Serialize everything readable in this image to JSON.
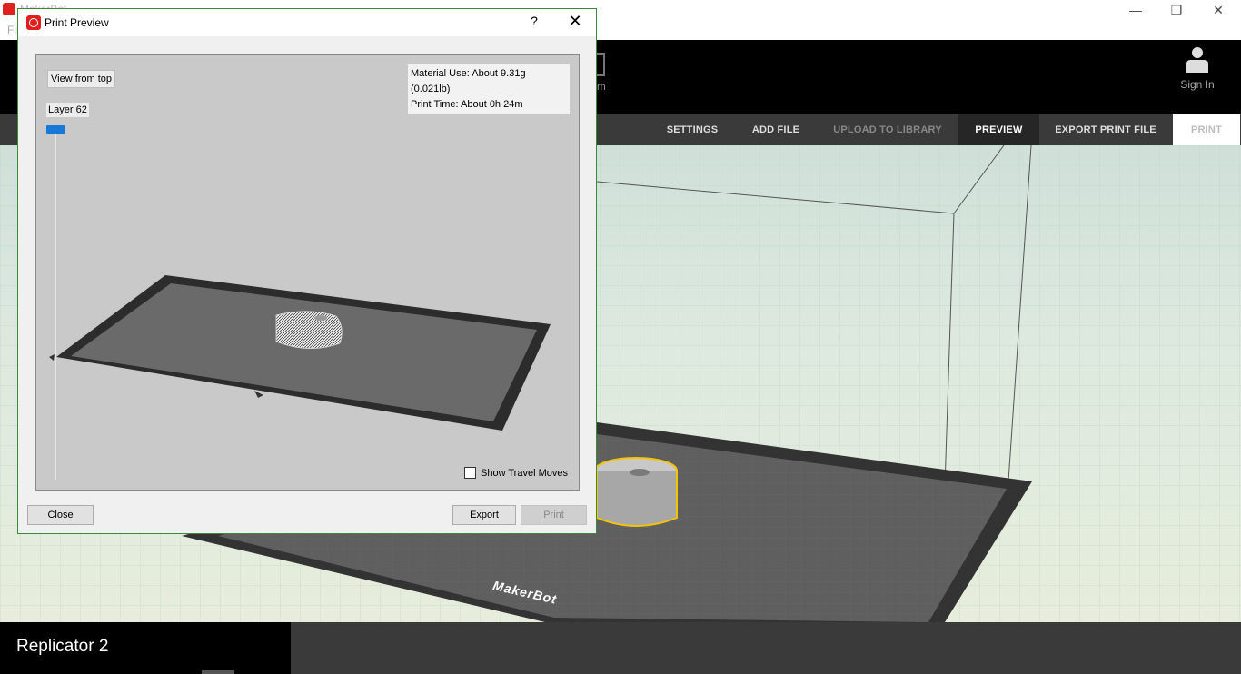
{
  "window": {
    "app_title": "MakerBot",
    "menu_file": "Fil",
    "minimize": "—",
    "restore": "❐",
    "close": "✕"
  },
  "topbar": {
    "learn_label": "rn",
    "signin_label": "Sign In"
  },
  "nav": {
    "settings": "SETTINGS",
    "add_file": "ADD FILE",
    "upload": "UPLOAD TO LIBRARY",
    "preview": "PREVIEW",
    "export": "EXPORT PRINT FILE",
    "print": "PRINT"
  },
  "scene": {
    "bed_logo": "MakerBot"
  },
  "bottombar": {
    "printer_name": "Replicator 2"
  },
  "dialog": {
    "title": "Print Preview",
    "help": "?",
    "close_glyph": "✕",
    "view_from_top": "View from top",
    "material_use": "Material Use: About 9.31g (0.021lb)",
    "print_time": "Print Time: About 0h 24m",
    "layer_label": "Layer 62",
    "show_travel_moves": "Show Travel Moves",
    "show_travel_checked": false,
    "close_button": "Close",
    "export_button": "Export",
    "print_button": "Print"
  },
  "colors": {
    "accent_red": "#e0201f",
    "slider_blue": "#1878d8",
    "selection_yellow": "#f5c400"
  }
}
